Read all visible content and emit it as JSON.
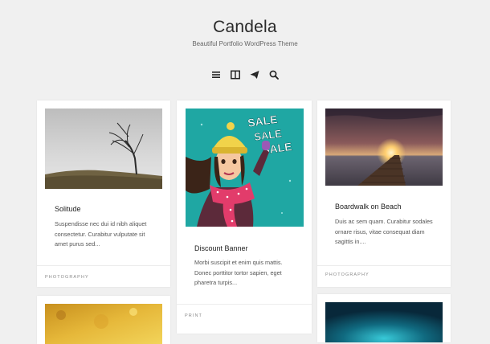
{
  "site": {
    "title": "Candela",
    "description": "Beautiful Portfolio WordPress Theme"
  },
  "nav": {
    "icons": [
      "menu-icon",
      "sidebar-icon",
      "social-send-icon",
      "search-icon"
    ]
  },
  "posts": [
    {
      "title": "Solitude",
      "excerpt_lines": [
        "Suspendisse nec dui id nibh aliquet",
        "consectetur. Curabitur vulputate sit",
        "amet purus sed..."
      ],
      "category": "PHOTOGRAPHY",
      "image": "lone-tree-on-hill"
    },
    {
      "title": "Discount Banner",
      "excerpt_lines": [
        "Morbi suscipit et enim quis mattis.",
        "Donec porttitor tortor sapien, eget",
        "pharetra turpis..."
      ],
      "category": "PRINT",
      "image": "sale-illustration-girl",
      "sale_words": [
        "SALE",
        "SALE",
        "SALE"
      ]
    },
    {
      "title": "Boardwalk on Beach",
      "excerpt_lines": [
        "Duis ac sem quam. Curabitur sodales",
        "ornare risus, vitae consequat diam",
        "sagittis in...."
      ],
      "category": "PHOTOGRAPHY",
      "image": "pier-sunset"
    },
    {
      "image": "golden-texture"
    },
    {
      "image": "teal-glow"
    }
  ],
  "colors": {
    "background": "#f0f0f0",
    "card": "#ffffff",
    "sale_teal": "#1fa7a3",
    "scarf_pink": "#e23c6b"
  }
}
